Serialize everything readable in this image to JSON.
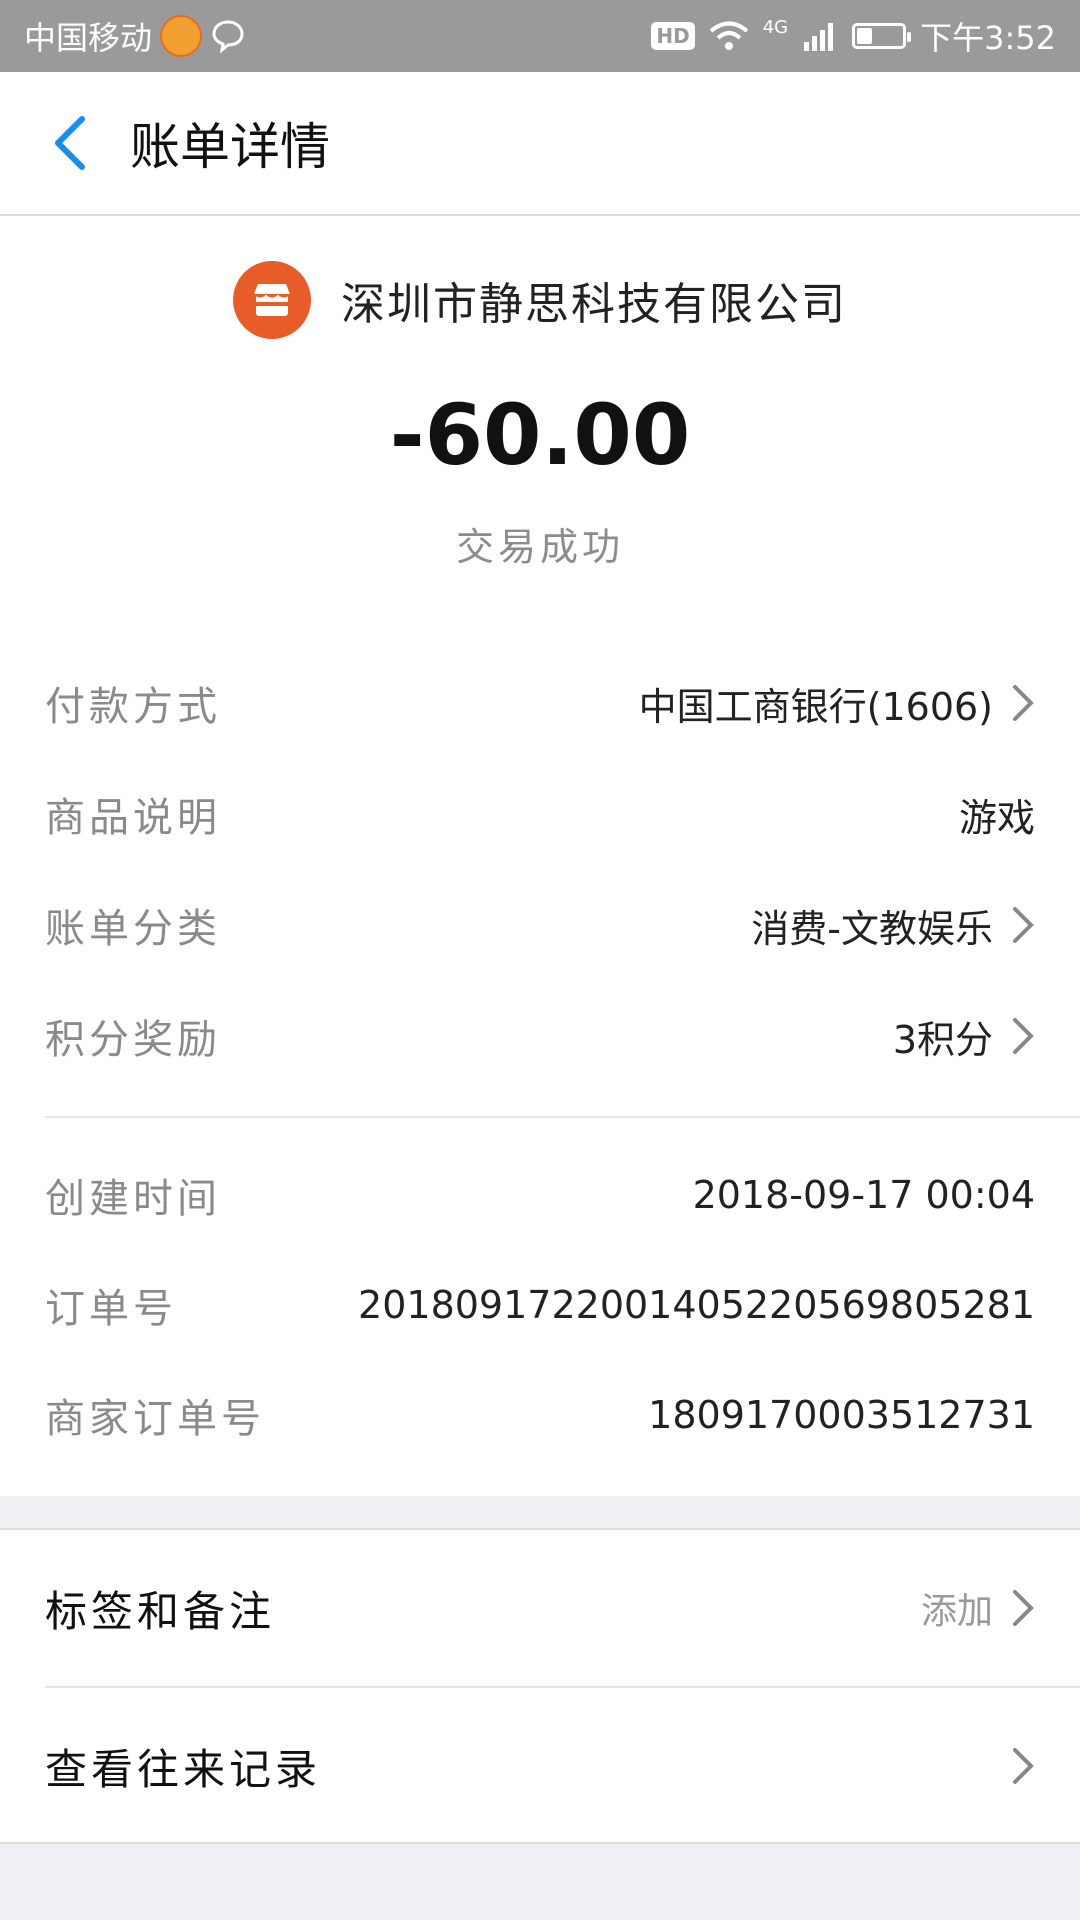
{
  "status_bar": {
    "carrier": "中国移动",
    "time": "下午3:52",
    "network": "4G",
    "hd": "HD",
    "battery_level": 0.35
  },
  "header": {
    "title": "账单详情"
  },
  "transaction": {
    "merchant": "深圳市静思科技有限公司",
    "amount": "-60.00",
    "status": "交易成功"
  },
  "details": [
    {
      "label": "付款方式",
      "value": "中国工商银行(1606)",
      "chevron": true
    },
    {
      "label": "商品说明",
      "value": "游戏",
      "chevron": false
    },
    {
      "label": "账单分类",
      "value": "消费-文教娱乐",
      "chevron": true
    },
    {
      "label": "积分奖励",
      "value": "3积分",
      "chevron": true
    }
  ],
  "meta": [
    {
      "label": "创建时间",
      "value": "2018-09-17 00:04"
    },
    {
      "label": "订单号",
      "value": "2018091722001405220569805281"
    },
    {
      "label": "商家订单号",
      "value": "1809170003512731"
    }
  ],
  "actions": [
    {
      "label": "标签和备注",
      "value": "添加"
    },
    {
      "label": "查看往来记录",
      "value": ""
    }
  ],
  "colors": {
    "accent": "#1a8cec",
    "merchant_logo": "#e85c2a",
    "status_bar": "#9a9a9a"
  }
}
